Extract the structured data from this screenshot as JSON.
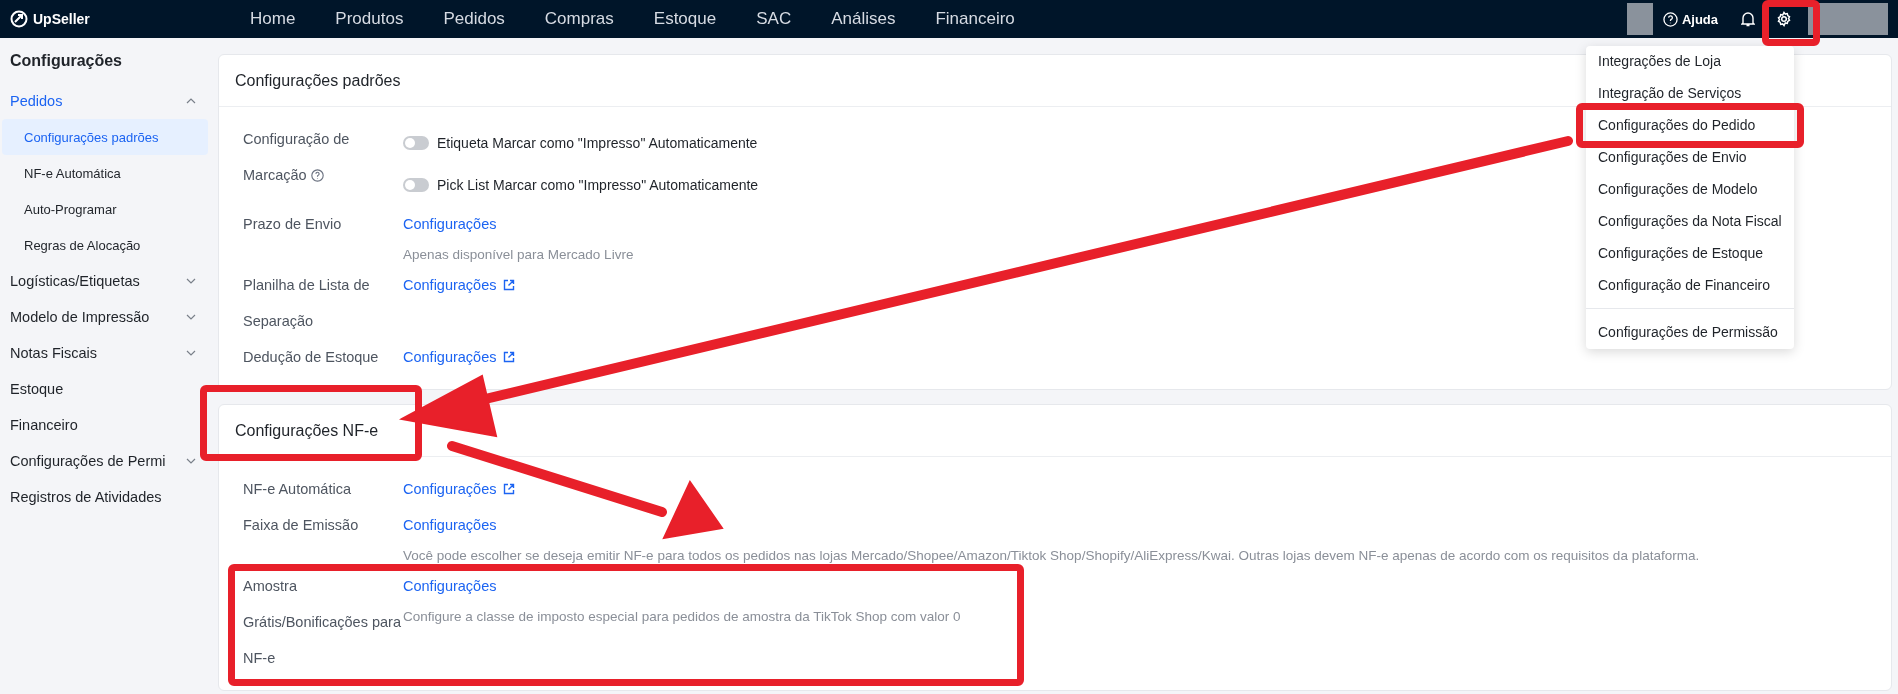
{
  "topbar": {
    "logo": "UpSeller",
    "nav": [
      {
        "label": "Home"
      },
      {
        "label": "Produtos"
      },
      {
        "label": "Pedidos"
      },
      {
        "label": "Compras"
      },
      {
        "label": "Estoque"
      },
      {
        "label": "SAC"
      },
      {
        "label": "Análises"
      },
      {
        "label": "Financeiro"
      }
    ],
    "help": "Ajuda"
  },
  "settings_menu": {
    "groups": [
      [
        "Integrações de Loja",
        "Integração de Serviços",
        "Configurações do Pedido",
        "Configurações de Envio",
        "Configurações de Modelo",
        "Configurações da Nota Fiscal",
        "Configurações de Estoque",
        "Configuração de Financeiro"
      ],
      [
        "Configurações de Permissão"
      ]
    ]
  },
  "sidebar": {
    "title": "Configurações",
    "items": [
      {
        "label": "Pedidos",
        "kind": "group",
        "expanded": true,
        "selected": true,
        "children": [
          {
            "label": "Configurações padrões",
            "selected": true
          },
          {
            "label": "NF-e Automática",
            "selected": false
          },
          {
            "label": "Auto-Programar",
            "selected": false
          },
          {
            "label": "Regras de Alocação",
            "selected": false
          }
        ]
      },
      {
        "label": "Logísticas/Etiquetas",
        "kind": "group",
        "expanded": false,
        "selected": false
      },
      {
        "label": "Modelo de Impressão",
        "kind": "group",
        "expanded": false,
        "selected": false
      },
      {
        "label": "Notas Fiscais",
        "kind": "group",
        "expanded": false,
        "selected": false
      },
      {
        "label": "Estoque",
        "kind": "link",
        "selected": false
      },
      {
        "label": "Financeiro",
        "kind": "link",
        "selected": false
      },
      {
        "label": "Configurações de Permi",
        "kind": "group",
        "expanded": false,
        "selected": false
      },
      {
        "label": "Registros de Atividades",
        "kind": "link",
        "selected": false
      }
    ]
  },
  "sections": [
    {
      "title": "Configurações padrões",
      "rows": [
        {
          "label": "Configuração de Marcação",
          "help": true,
          "values": [
            {
              "kind": "toggle",
              "label": "Etiqueta Marcar como \"Impresso\" Automaticamente",
              "on": false
            },
            {
              "kind": "toggle",
              "label": "Pick List Marcar como \"Impresso\" Automaticamente",
              "on": false
            }
          ]
        },
        {
          "label": "Prazo de Envio",
          "values": [
            {
              "kind": "link",
              "label": "Configurações",
              "external": false
            },
            {
              "kind": "note",
              "label": "Apenas disponível para Mercado Livre"
            }
          ]
        },
        {
          "label": "Planilha de Lista de Separação",
          "values": [
            {
              "kind": "link",
              "label": "Configurações",
              "external": true
            }
          ]
        },
        {
          "label": "Dedução de Estoque",
          "values": [
            {
              "kind": "link",
              "label": "Configurações",
              "external": true
            }
          ]
        }
      ]
    },
    {
      "title": "Configurações NF-e",
      "rows": [
        {
          "label": "NF-e Automática",
          "values": [
            {
              "kind": "link",
              "label": "Configurações",
              "external": true
            }
          ]
        },
        {
          "label": "Faixa de Emissão",
          "values": [
            {
              "kind": "link",
              "label": "Configurações",
              "external": false
            },
            {
              "kind": "note",
              "label": "Você pode escolher se deseja emitir NF-e para todos os pedidos nas lojas Mercado/Shopee/Amazon/Tiktok Shop/Shopify/AliExpress/Kwai. Outras lojas devem NF-e apenas de acordo com os requisitos da plataforma."
            }
          ]
        },
        {
          "label": "Amostra Grátis/Bonificações para NF-e",
          "values": [
            {
              "kind": "link",
              "label": "Configurações",
              "external": false
            },
            {
              "kind": "note",
              "label": "Configure a classe de imposto especial para pedidos de amostra da TikTok Shop com valor 0"
            }
          ]
        }
      ]
    }
  ]
}
